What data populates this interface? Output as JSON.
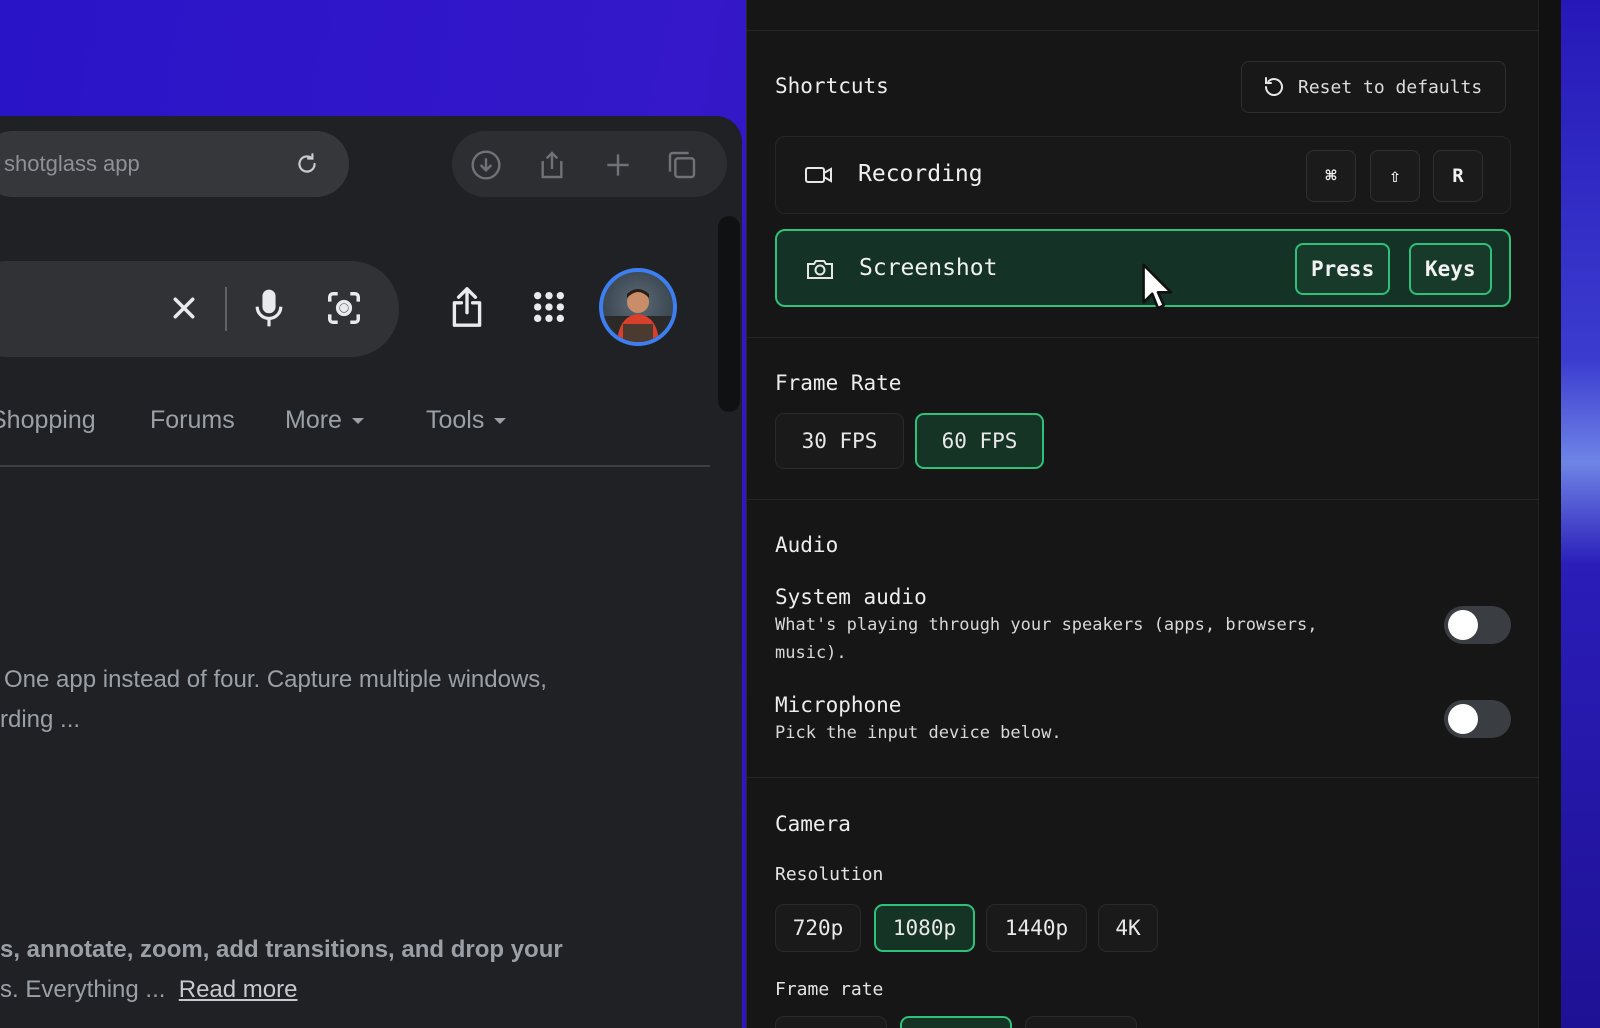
{
  "browser": {
    "address_text": "shotglass app",
    "nav_tabs": [
      "Shopping",
      "Forums",
      "More",
      "Tools"
    ],
    "snippet1": [
      "One app instead of four. Capture multiple windows,",
      "rding ..."
    ],
    "snippet2": [
      "s, annotate, zoom, add transitions, and drop your",
      "s. Everything ..."
    ],
    "read_more": "Read more"
  },
  "panel": {
    "shortcuts_title": "Shortcuts",
    "reset_label": "Reset to defaults",
    "recording": {
      "label": "Recording",
      "keys": [
        "⌘",
        "⇧",
        "R"
      ]
    },
    "screenshot": {
      "label": "Screenshot",
      "keys": [
        "Press",
        "Keys"
      ]
    },
    "frame_rate_title": "Frame Rate",
    "frame_rate_options": [
      "30 FPS",
      "60 FPS"
    ],
    "frame_rate_selected": "60 FPS",
    "audio_title": "Audio",
    "system_audio": {
      "label": "System audio",
      "desc": "What's playing through your speakers (apps, browsers, music).",
      "enabled": false
    },
    "microphone": {
      "label": "Microphone",
      "desc": "Pick the input device below.",
      "enabled": false
    },
    "camera_title": "Camera",
    "resolution_label": "Resolution",
    "resolution_options": [
      "720p",
      "1080p",
      "1440p",
      "4K"
    ],
    "resolution_selected": "1080p",
    "camera_frame_rate_label": "Frame rate"
  },
  "colors": {
    "accent_green": "#2fc07a",
    "panel_bg": "#161616",
    "desktop_blue": "#2a14c8"
  }
}
